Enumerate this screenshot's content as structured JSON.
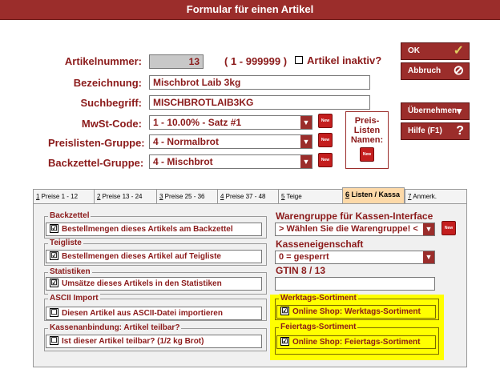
{
  "window": {
    "title": "Formular für einen Artikel"
  },
  "form": {
    "artikelnummer": {
      "label": "Artikelnummer:",
      "value": "13",
      "range": "( 1 - 999999 )",
      "inaktiv_label": "Artikel inaktiv?"
    },
    "bezeichnung": {
      "label": "Bezeichnung:",
      "value": "Mischbrot Laib 3kg"
    },
    "suchbegriff": {
      "label": "Suchbegriff:",
      "value": "MISCHBROTLAIB3KG"
    },
    "mwst": {
      "label": "MwSt-Code:",
      "value": "1 - 10.00% - Satz #1"
    },
    "preislisten": {
      "label": "Preislisten-Gruppe:",
      "value": "4 - Normalbrot"
    },
    "backzettel": {
      "label": "Backzettel-Gruppe:",
      "value": "4 - Mischbrot"
    },
    "new_label": "New",
    "preislisten_namen": {
      "line1": "Preis-",
      "line2": "Listen",
      "line3": "Namen:"
    }
  },
  "buttons": {
    "ok": "OK",
    "abbruch": "Abbruch",
    "uebernehmen": "Übernehmen",
    "hilfe": "Hilfe (F1)"
  },
  "tabs": [
    {
      "key": "1",
      "label": " Preise 1 - 12"
    },
    {
      "key": "2",
      "label": " Preise 13 - 24"
    },
    {
      "key": "3",
      "label": " Preise 25 - 36"
    },
    {
      "key": "4",
      "label": " Preise 37 - 48"
    },
    {
      "key": "5",
      "label": " Teige"
    },
    {
      "key": "6",
      "label": " Listen / Kassa"
    },
    {
      "key": "7",
      "label": " Anmerk."
    }
  ],
  "panel": {
    "backzettel": {
      "title": "Backzettel",
      "item": "Bestellmengen dieses Artikels am Backzettel",
      "checked": "☑"
    },
    "teigliste": {
      "title": "Teigliste",
      "item": "Bestellmengen dieses Artikel auf Teigliste",
      "checked": "☑"
    },
    "statistiken": {
      "title": "Statistiken",
      "item": "Umsätze dieses Artikels in den Statistiken",
      "checked": "☑"
    },
    "ascii": {
      "title": "ASCII Import",
      "item": "Diesen Artikel aus ASCII-Datei importieren",
      "checked": "☐"
    },
    "kassen": {
      "title": "Kassenanbindung: Artikel teilbar?",
      "item": "Ist dieser Artikel teilbar? (1/2 kg Brot)",
      "checked": "☐"
    },
    "warengruppe": {
      "label": "Warengruppe für Kassen-Interface",
      "value": "> Wählen Sie die Warengruppe! <"
    },
    "kasseneigenschaft": {
      "label": "Kasseneigenschaft",
      "value": "0 = gesperrt"
    },
    "gtin": {
      "label": "GTIN 8 / 13",
      "value": ""
    },
    "werktags": {
      "title": "Werktags-Sortiment",
      "item": "Online Shop: Werktags-Sortiment",
      "checked": "☑"
    },
    "feiertags": {
      "title": "Feiertags-Sortiment",
      "item": "Online Shop: Feiertags-Sortiment",
      "checked": "☑"
    }
  }
}
